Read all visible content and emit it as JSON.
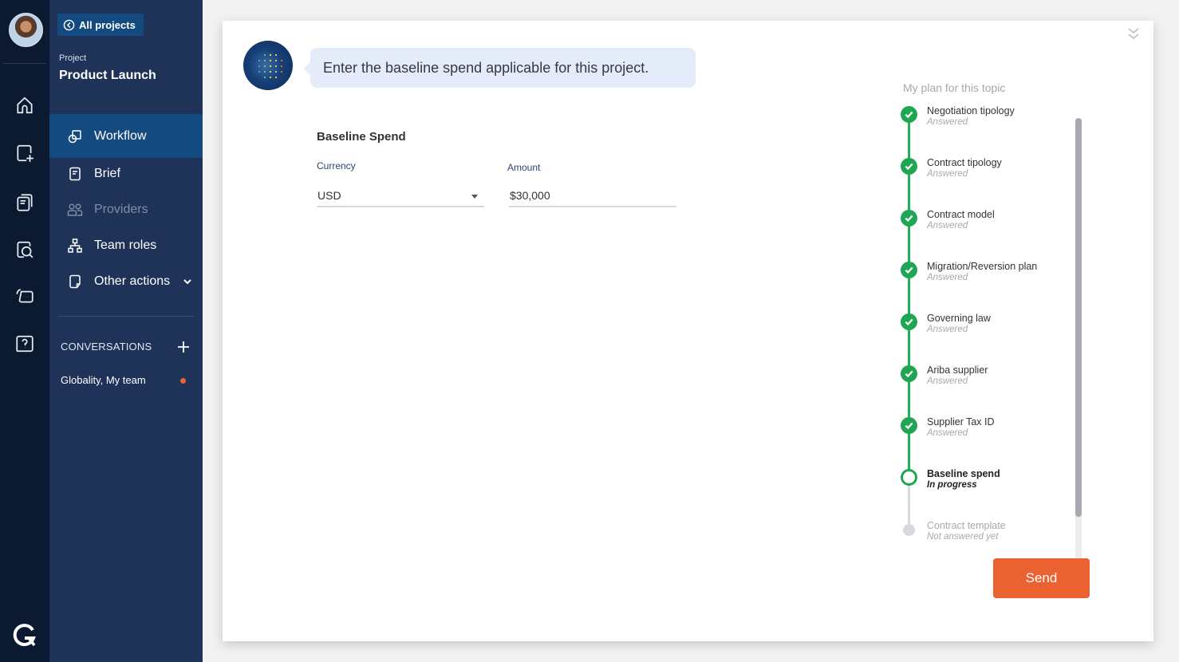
{
  "rail": {
    "icons": [
      "home-icon",
      "new-project-icon",
      "projects-icon",
      "search-docs-icon",
      "chat-icon",
      "help-icon"
    ],
    "logo": "G"
  },
  "sidebar": {
    "back_label": "All projects",
    "project_label": "Project",
    "project_name": "Product Launch",
    "nav": [
      {
        "label": "Workflow",
        "icon": "workflow-icon",
        "state": "active"
      },
      {
        "label": "Brief",
        "icon": "brief-icon",
        "state": "normal"
      },
      {
        "label": "Providers",
        "icon": "providers-icon",
        "state": "disabled"
      },
      {
        "label": "Team roles",
        "icon": "team-roles-icon",
        "state": "normal"
      },
      {
        "label": "Other actions",
        "icon": "other-actions-icon",
        "state": "normal"
      }
    ],
    "conversations_header": "CONVERSATIONS",
    "conversations": [
      {
        "label": "Globality, My team",
        "unread": true
      }
    ]
  },
  "main": {
    "bot_message": "Enter the baseline spend applicable for this project.",
    "form": {
      "title": "Baseline Spend",
      "currency_label": "Currency",
      "currency_value": "USD",
      "amount_label": "Amount",
      "amount_value": "$30,000"
    },
    "plan": {
      "title": "My plan for this topic",
      "steps": [
        {
          "name": "Negotiation tipology",
          "status": "Answered",
          "state": "done"
        },
        {
          "name": "Contract tipology",
          "status": "Answered",
          "state": "done"
        },
        {
          "name": "Contract model",
          "status": "Answered",
          "state": "done"
        },
        {
          "name": "Migration/Reversion plan",
          "status": "Answered",
          "state": "done"
        },
        {
          "name": "Governing law",
          "status": "Answered",
          "state": "done"
        },
        {
          "name": "Ariba supplier",
          "status": "Answered",
          "state": "done"
        },
        {
          "name": "Supplier Tax ID",
          "status": "Answered",
          "state": "done"
        },
        {
          "name": "Baseline spend",
          "status": "In progress",
          "state": "current"
        },
        {
          "name": "Contract template",
          "status": "Not answered yet",
          "state": "todo"
        }
      ]
    },
    "send_label": "Send"
  },
  "colors": {
    "rail_bg": "#0c1a31",
    "sidebar_bg": "#1f3359",
    "active_bg": "#134a80",
    "success": "#1fa653",
    "accent": "#ea6132",
    "bubble_bg": "#e4ecf9"
  }
}
